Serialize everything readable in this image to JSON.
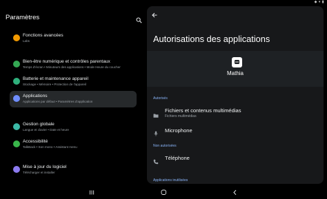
{
  "status": {
    "icons": "◆ ▾ ▮"
  },
  "settings": {
    "title": "Paramètres",
    "items": [
      {
        "label": "Fonctions avancées",
        "sub": "Labs",
        "color": "#f29900"
      },
      {
        "label": "Bien-être numérique et contrôles parentaux",
        "sub": "Temps d'écran  •  Minuteurs des applications  •  Mode Heure du coucher",
        "color": "#34a853"
      },
      {
        "label": "Batterie et maintenance appareil",
        "sub": "Stockage  •  Mémoire  •  Protection de l'appareil",
        "color": "#2fb07c"
      },
      {
        "label": "Applications",
        "sub": "Applications par défaut  •  Paramètres d'application",
        "color": "#6f8dfc"
      },
      {
        "label": "Gestion globale",
        "sub": "Langue et clavier  •  Date et heure",
        "color": "#3bb9a6"
      },
      {
        "label": "Accessibilité",
        "sub": "TalkBack  •  Son mono  •  Assistant menu",
        "color": "#39b54a"
      },
      {
        "label": "Mise à jour du logiciel",
        "sub": "Télécharger et installer",
        "color": "#8c7bf0"
      }
    ]
  },
  "detail": {
    "title": "Autorisations des applications",
    "app_name": "Mathia",
    "allowed_header": "Autorisés",
    "allowed": [
      {
        "label": "Fichiers et contenus multimédias",
        "sub": "Fichiers multimédias",
        "icon": "folder-icon"
      },
      {
        "label": "Microphone",
        "sub": "",
        "icon": "microphone-icon"
      }
    ],
    "denied_header": "Non autorisées",
    "denied": [
      {
        "label": "Téléphone",
        "sub": "",
        "icon": "phone-icon"
      }
    ],
    "unused_header": "Applications inutilisées"
  }
}
